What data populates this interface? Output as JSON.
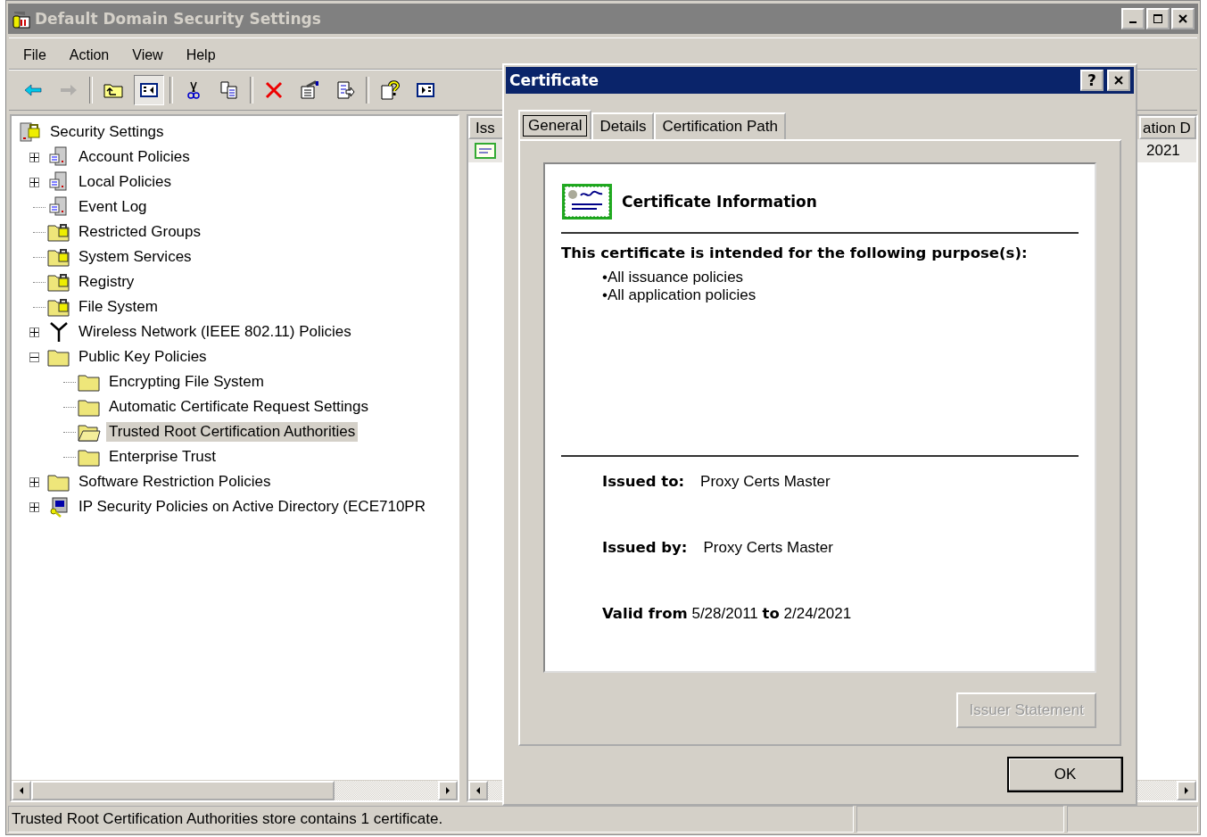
{
  "window": {
    "title": "Default Domain Security Settings"
  },
  "menu": [
    "File",
    "Action",
    "View",
    "Help"
  ],
  "toolbar": [
    {
      "kind": "back",
      "disabled": false,
      "pressed": false
    },
    {
      "kind": "forward",
      "disabled": true,
      "pressed": false
    },
    {
      "kind": "sep"
    },
    {
      "kind": "up",
      "pressed": false
    },
    {
      "kind": "tree",
      "pressed": true
    },
    {
      "kind": "sep"
    },
    {
      "kind": "cut",
      "pressed": false
    },
    {
      "kind": "copy",
      "pressed": false
    },
    {
      "kind": "sep"
    },
    {
      "kind": "delete",
      "pressed": false
    },
    {
      "kind": "properties",
      "pressed": false
    },
    {
      "kind": "export",
      "pressed": false
    },
    {
      "kind": "sep"
    },
    {
      "kind": "help",
      "pressed": false
    },
    {
      "kind": "pane",
      "pressed": false
    }
  ],
  "tree": {
    "label": "Security Settings",
    "kind": "root",
    "items": [
      {
        "label": "Account Policies",
        "kind": "policy",
        "expanded": false,
        "selected": false
      },
      {
        "label": "Local Policies",
        "kind": "policy",
        "expanded": false,
        "selected": false
      },
      {
        "label": "Event Log",
        "kind": "policy",
        "selected": false
      },
      {
        "label": "Restricted Groups",
        "kind": "lockfolder",
        "selected": false
      },
      {
        "label": "System Services",
        "kind": "lockfolder",
        "selected": false
      },
      {
        "label": "Registry",
        "kind": "lockfolder",
        "selected": false
      },
      {
        "label": "File System",
        "kind": "lockfolder",
        "selected": false
      },
      {
        "label": "Wireless Network (IEEE 802.11) Policies",
        "kind": "antenna",
        "expanded": false,
        "selected": false
      },
      {
        "label": "Public Key Policies",
        "kind": "folder",
        "expanded": true,
        "selected": false,
        "children": [
          {
            "label": "Encrypting File System",
            "kind": "folder",
            "selected": false
          },
          {
            "label": "Automatic Certificate Request Settings",
            "kind": "folder",
            "selected": false
          },
          {
            "label": "Trusted Root Certification Authorities",
            "kind": "openfolder",
            "selected": true
          },
          {
            "label": "Enterprise Trust",
            "kind": "folder",
            "selected": false
          }
        ]
      },
      {
        "label": "Software Restriction Policies",
        "kind": "folder",
        "expanded": false,
        "selected": false
      },
      {
        "label": "IP Security Policies on Active Directory (ECE710PR",
        "kind": "ip",
        "expanded": false,
        "selected": false
      }
    ]
  },
  "list": {
    "columns": [
      "Iss",
      "ation D"
    ],
    "rows": [
      {
        "cells": [
          "",
          "2021"
        ]
      }
    ]
  },
  "status_bar": {
    "text": "Trusted Root Certification Authorities store contains 1 certificate."
  },
  "dialog": {
    "title": "Certificate",
    "help_button": "?",
    "tabs": [
      {
        "label": "General",
        "selected": true
      },
      {
        "label": "Details",
        "selected": false
      },
      {
        "label": "Certification Path",
        "selected": false
      }
    ],
    "heading": "Certificate Information",
    "purpose_title": "This certificate is intended for the following purpose(s):",
    "purposes": [
      "•All issuance policies",
      "•All application policies"
    ],
    "issued_to": {
      "label": "Issued to:",
      "value": "Proxy Certs Master"
    },
    "issued_by": {
      "label": "Issued by:",
      "value": "Proxy Certs Master"
    },
    "validity": "**Valid from** 5/28/2011 **to** 2/24/2021",
    "issuer_statement": {
      "label": "Issuer Statement",
      "disabled": true
    },
    "ok": "OK"
  }
}
